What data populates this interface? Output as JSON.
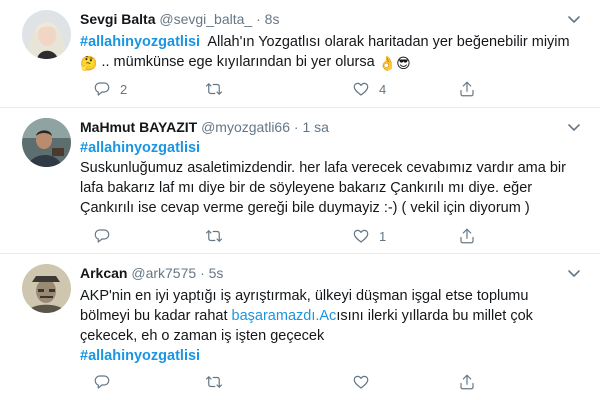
{
  "tweets": [
    {
      "name": "Sevgi Balta",
      "handle": "@sevgi_balta_",
      "dot": "·",
      "time": "8s",
      "hashtag": "#allahinyozgatlisi",
      "text1": "Allah'ın Yozgatlısı olarak haritadan yer beğenebilir miyim",
      "emoji_think": "🤔",
      "text2": ".. mümkünse ege kıyılarından bi yer olursa",
      "emoji_ok": "👌",
      "emoji_cool": "😎",
      "replies": "2",
      "retweets": "",
      "likes": "4"
    },
    {
      "name": "MaHmut BAYAZIT",
      "handle": "@myozgatli66",
      "dot": "·",
      "time": "1 sa",
      "hashtag": "#allahinyozgatlisi",
      "text_l1": "Suskunluğumuz asaletimizdendir. her lafa verecek cevabımız vardır ama bir",
      "text_l2": "lafa bakarız laf mı diye bir de söyleyene bakarız Çankırılı mı diye. eğer",
      "text_l3": "Çankırılı ise cevap verme gereği bile duymayiz :-)  ( vekil için diyorum )",
      "replies": "",
      "retweets": "",
      "likes": "1"
    },
    {
      "name": "Arkcan",
      "handle": "@ark7575",
      "dot": "·",
      "time": "5s",
      "text_l1": "AKP'nin en iyi yaptığı iş ayrıştırmak, ülkeyi düşman işgal etse toplumu",
      "text_l2a": "bölmeyi bu kadar rahat ",
      "text_link": "başaramazdı.Ac",
      "text_l2b": "ısını ilerki yıllarda bu millet çok",
      "text_l3": "çekecek, eh o zaman iş işten geçecek",
      "hashtag": "#allahinyozgatlisi",
      "replies": "",
      "retweets": "",
      "likes": ""
    }
  ],
  "icons": {
    "reply": "reply-icon",
    "retweet": "retweet-icon",
    "like": "heart-icon",
    "share": "share-icon",
    "more": "chevron-down-icon"
  },
  "colors": {
    "hashtag": "#1b95e0",
    "secondary_text": "#657786",
    "divider": "#e6ecf0"
  }
}
